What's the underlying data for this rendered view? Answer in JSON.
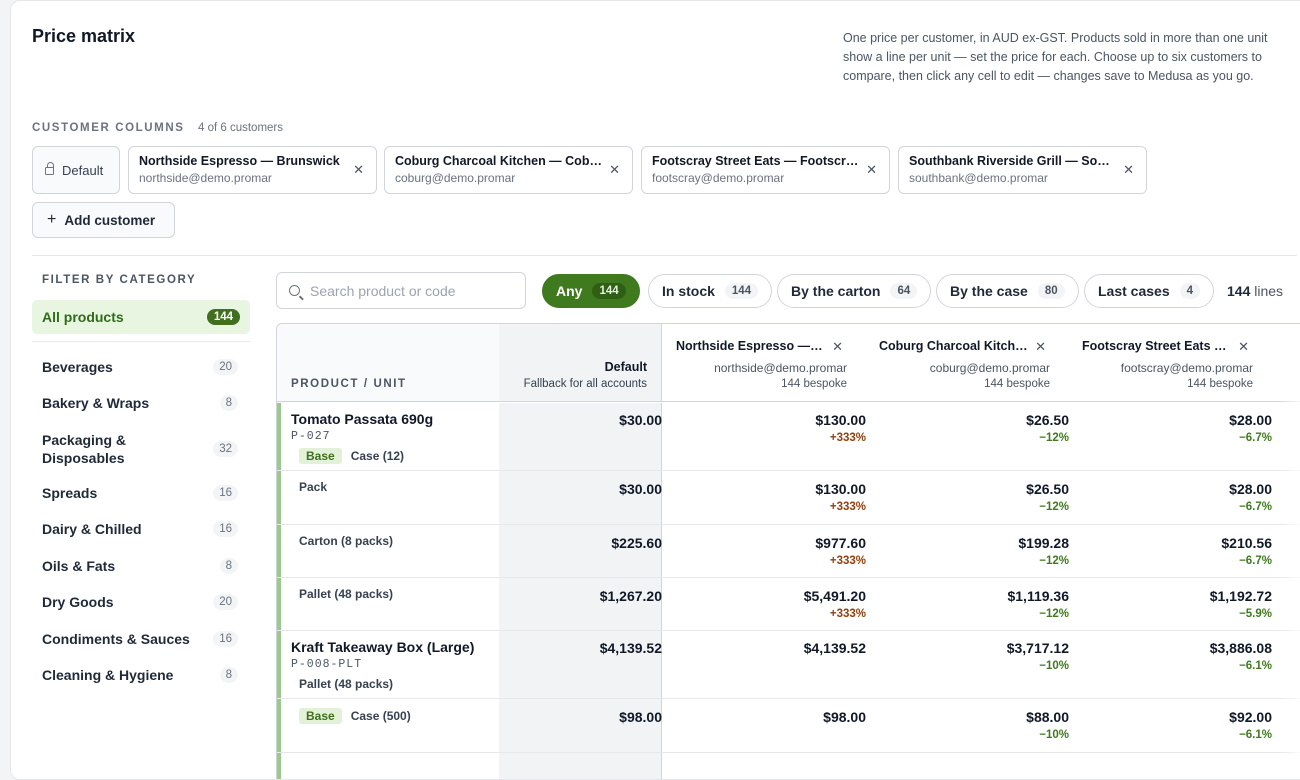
{
  "page": {
    "title": "Price matrix",
    "description": "One price per customer, in AUD ex-GST. Products sold in more than one unit show a line per unit — set the price for each. Choose up to six customers to compare, then click any cell to edit — changes save to Medusa as you go."
  },
  "customer_columns": {
    "label": "CUSTOMER COLUMNS",
    "count": "4 of 6 customers",
    "default_label": "Default",
    "add_label": "Add customer",
    "chips": [
      {
        "name": "Northside Espresso — Brunswick",
        "email": "northside@demo.promar"
      },
      {
        "name": "Coburg Charcoal Kitchen — Coburg",
        "email": "coburg@demo.promar"
      },
      {
        "name": "Footscray Street Eats — Footscray",
        "email": "footscray@demo.promar"
      },
      {
        "name": "Southbank Riverside Grill — Southbank",
        "email": "southbank@demo.promar"
      }
    ]
  },
  "filter": {
    "label": "FILTER BY CATEGORY",
    "all": {
      "label": "All products",
      "count": "144"
    },
    "categories": [
      {
        "label": "Beverages",
        "count": "20"
      },
      {
        "label": "Bakery & Wraps",
        "count": "8"
      },
      {
        "label": "Packaging & Disposables",
        "count": "32"
      },
      {
        "label": "Spreads",
        "count": "16"
      },
      {
        "label": "Dairy & Chilled",
        "count": "16"
      },
      {
        "label": "Oils & Fats",
        "count": "8"
      },
      {
        "label": "Dry Goods",
        "count": "20"
      },
      {
        "label": "Condiments & Sauces",
        "count": "16"
      },
      {
        "label": "Cleaning & Hygiene",
        "count": "8"
      }
    ]
  },
  "toolbar": {
    "search_placeholder": "Search product or code",
    "pills": [
      {
        "label": "Any",
        "count": "144"
      },
      {
        "label": "In stock",
        "count": "144"
      },
      {
        "label": "By the carton",
        "count": "64"
      },
      {
        "label": "By the case",
        "count": "80"
      },
      {
        "label": "Last cases",
        "count": "4"
      }
    ],
    "lines_count": "144",
    "lines_suffix": "lines"
  },
  "table": {
    "product_header": "PRODUCT / UNIT",
    "default_header": "Default",
    "default_sub": "Fallback for all accounts",
    "customers": [
      {
        "name": "Northside Espresso — Brunswick",
        "email": "northside@demo.promar",
        "bespoke": "144 bespoke"
      },
      {
        "name": "Coburg Charcoal Kitchen — Coburg",
        "email": "coburg@demo.promar",
        "bespoke": "144 bespoke"
      },
      {
        "name": "Footscray Street Eats — Footscray",
        "email": "footscray@demo.promar",
        "bespoke": "144 bespoke"
      }
    ],
    "rows": [
      {
        "name": "Tomato Passata 690g",
        "code": "P-027",
        "base": "Base",
        "unit": "Case (12)",
        "default": "$30.00",
        "cells": [
          {
            "price": "$130.00",
            "delta": "+333%"
          },
          {
            "price": "$26.50",
            "delta": "−12%"
          },
          {
            "price": "$28.00",
            "delta": "−6.7%"
          }
        ]
      },
      {
        "unit": "Pack",
        "default": "$30.00",
        "cells": [
          {
            "price": "$130.00",
            "delta": "+333%"
          },
          {
            "price": "$26.50",
            "delta": "−12%"
          },
          {
            "price": "$28.00",
            "delta": "−6.7%"
          }
        ]
      },
      {
        "unit": "Carton (8 packs)",
        "default": "$225.60",
        "cells": [
          {
            "price": "$977.60",
            "delta": "+333%"
          },
          {
            "price": "$199.28",
            "delta": "−12%"
          },
          {
            "price": "$210.56",
            "delta": "−6.7%"
          }
        ]
      },
      {
        "unit": "Pallet (48 packs)",
        "default": "$1,267.20",
        "cells": [
          {
            "price": "$5,491.20",
            "delta": "+333%"
          },
          {
            "price": "$1,119.36",
            "delta": "−12%"
          },
          {
            "price": "$1,192.72",
            "delta": "−5.9%"
          }
        ]
      },
      {
        "name": "Kraft Takeaway Box (Large)",
        "code": "P-008-PLT",
        "unit": "Pallet (48 packs)",
        "default": "$4,139.52",
        "cells": [
          {
            "price": "$4,139.52",
            "delta": ""
          },
          {
            "price": "$3,717.12",
            "delta": "−10%"
          },
          {
            "price": "$3,886.08",
            "delta": "−6.1%"
          }
        ]
      },
      {
        "base": "Base",
        "unit": "Case (500)",
        "default": "$98.00",
        "cells": [
          {
            "price": "$98.00",
            "delta": ""
          },
          {
            "price": "$88.00",
            "delta": "−10%"
          },
          {
            "price": "$92.00",
            "delta": "−6.1%"
          }
        ]
      }
    ]
  },
  "colors": {
    "accent": "#3f7a1e",
    "accent_light": "#e8f5e0",
    "up": "#92400e",
    "down": "#3f7a1e"
  }
}
